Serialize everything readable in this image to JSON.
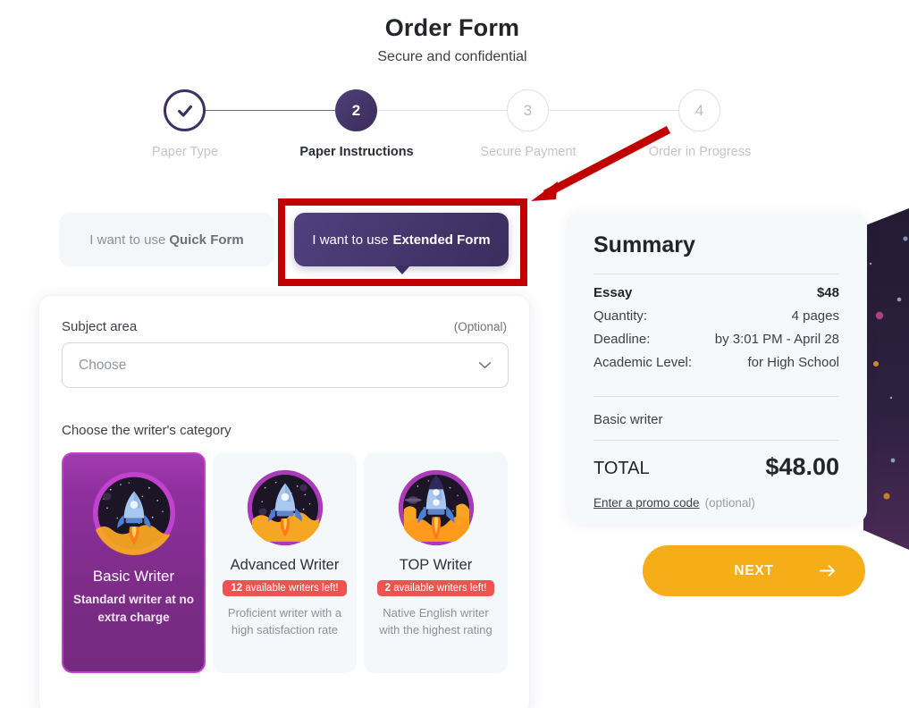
{
  "header": {
    "title": "Order Form",
    "subtitle": "Secure and confidential"
  },
  "stepper": {
    "steps": [
      {
        "number": "1",
        "label": "Paper Type",
        "state": "complete",
        "icon": "check-icon"
      },
      {
        "number": "2",
        "label": "Paper Instructions",
        "state": "current"
      },
      {
        "number": "3",
        "label": "Secure Payment",
        "state": "upcoming"
      },
      {
        "number": "4",
        "label": "Order in Progress",
        "state": "upcoming"
      }
    ]
  },
  "form_toggle": {
    "quick_prefix": "I want to use ",
    "quick_strong": "Quick Form",
    "extended_prefix": "I want to use ",
    "extended_strong": "Extended Form",
    "active": "extended"
  },
  "form": {
    "subject_label": "Subject area",
    "optional_tag": "(Optional)",
    "subject_placeholder": "Choose",
    "category_label": "Choose the writer's category",
    "writers": [
      {
        "name": "Basic Writer",
        "badge": null,
        "badge_count": null,
        "description": "Standard writer at no extra charge",
        "selected": true
      },
      {
        "name": "Advanced Writer",
        "badge_count": "12",
        "badge": " available writers left!",
        "description": "Proficient writer with a high satisfaction rate",
        "selected": false
      },
      {
        "name": "TOP Writer",
        "badge_count": "2",
        "badge": " available writers left!",
        "description": "Native English writer with the highest rating",
        "selected": false
      }
    ]
  },
  "summary": {
    "title": "Summary",
    "rows": [
      {
        "label": "Essay",
        "value": "$48",
        "bold": true
      },
      {
        "label": "Quantity:",
        "value": "4 pages",
        "bold": false
      },
      {
        "label": "Deadline:",
        "value": "by 3:01 PM - April 28",
        "bold": false
      },
      {
        "label": "Academic Level:",
        "value": "for High School",
        "bold": false
      }
    ],
    "writer_line": "Basic writer",
    "total_label": "TOTAL",
    "total_value": "$48.00",
    "promo_link": "Enter a promo code",
    "promo_optional": "(optional)"
  },
  "next_button": {
    "label": "NEXT",
    "icon": "arrow-right-icon"
  },
  "colors": {
    "brand_purple": "#3b2d5c",
    "selected_card": "#8f2f9e",
    "badge_red": "#ef5350",
    "next_yellow": "#f5ad18",
    "annotation_red": "#c00000",
    "summary_bg": "#f6f9fc"
  }
}
